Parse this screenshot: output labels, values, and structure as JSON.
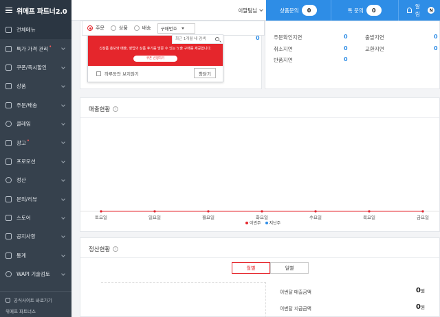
{
  "header": {
    "logo": "위메프 파트너2.0",
    "user_name": "이팔팀님",
    "inquiries": [
      {
        "label": "상품문의",
        "count": "0"
      },
      {
        "label": "톡 문의",
        "count": "0"
      }
    ],
    "notice_label": "알림",
    "notice_badge": "N"
  },
  "sidebar": {
    "items": [
      {
        "label": "전체메뉴",
        "icon": "grid-icon",
        "chevron": false,
        "dot": false
      },
      {
        "label": "특가 가격 관리",
        "icon": "price-tag-icon",
        "chevron": true,
        "dot": true
      },
      {
        "label": "쿠폰/즉시할인",
        "icon": "coupon-icon",
        "chevron": true,
        "dot": false
      },
      {
        "label": "상품",
        "icon": "product-box-icon",
        "chevron": true,
        "dot": false
      },
      {
        "label": "주문/배송",
        "icon": "delivery-truck-icon",
        "chevron": true,
        "dot": false
      },
      {
        "label": "클레임",
        "icon": "claim-icon",
        "chevron": true,
        "dot": false
      },
      {
        "label": "광고",
        "icon": "ad-icon",
        "chevron": true,
        "dot": true
      },
      {
        "label": "프로모션",
        "icon": "promotion-icon",
        "chevron": true,
        "dot": false
      },
      {
        "label": "정산",
        "icon": "settlement-icon",
        "chevron": true,
        "dot": false
      },
      {
        "label": "문의/리뷰",
        "icon": "chat-icon",
        "chevron": true,
        "dot": false
      },
      {
        "label": "스토어",
        "icon": "store-icon",
        "chevron": true,
        "dot": false
      },
      {
        "label": "공지사항",
        "icon": "megaphone-icon",
        "chevron": true,
        "dot": false
      },
      {
        "label": "통계",
        "icon": "stats-icon",
        "chevron": true,
        "dot": false
      },
      {
        "label": "WAPI 기술검토",
        "icon": "help-icon",
        "chevron": true,
        "dot": false
      }
    ],
    "footer": [
      {
        "label": "공식사이트 바로가기",
        "icon": "external-link-icon"
      },
      {
        "label": "위메프 파트너스",
        "icon": ""
      }
    ]
  },
  "search": {
    "radios": [
      {
        "label": "주문",
        "checked": true
      },
      {
        "label": "상품",
        "checked": false
      },
      {
        "label": "배송",
        "checked": false
      }
    ],
    "select_value": "구매번호",
    "placeholder": "최근 1개월 내 검색"
  },
  "popup": {
    "banner_text": "신상품 홍보와 매출, 영업의 상품 후기를 방문 수 있는 노출 구매를 제공합니다.",
    "banner_button": "쿠폰 신청하기",
    "dont_show_label": "하루동안 보지않기",
    "close_label": "창닫기"
  },
  "summary_right": {
    "rows": [
      {
        "label": "주문확인지연",
        "value": "0"
      },
      {
        "label": "취소지연",
        "value": "0"
      },
      {
        "label": "반품지연",
        "value": "0"
      }
    ],
    "rows2": [
      {
        "label": "출발지연",
        "value": "0"
      },
      {
        "label": "교환지연",
        "value": "0"
      }
    ],
    "left_value": "0"
  },
  "sales": {
    "title": "매출현황",
    "legend": [
      {
        "label": "이번주",
        "color": "#e5262c"
      },
      {
        "label": "지난주",
        "color": "#2e8de6"
      }
    ]
  },
  "chart_data": {
    "type": "line",
    "categories": [
      "토요일",
      "일요일",
      "월요일",
      "화요일",
      "수요일",
      "목요일",
      "금요일"
    ],
    "series": [
      {
        "name": "이번주",
        "values": [
          0,
          0,
          0,
          0,
          0,
          0,
          0
        ],
        "color": "#e5262c"
      },
      {
        "name": "지난주",
        "values": [
          0,
          0,
          0,
          0,
          0,
          0,
          0
        ],
        "color": "#2e8de6"
      }
    ],
    "ylim": [
      0,
      1
    ],
    "grid": false,
    "legend_position": "bottom-center"
  },
  "settlement": {
    "title": "정산현황",
    "tabs": [
      {
        "label": "월별",
        "active": true
      },
      {
        "label": "일별",
        "active": false
      }
    ],
    "rows": [
      {
        "label": "이번달 매출금액",
        "value": "0",
        "unit": "원"
      },
      {
        "label": "이번달 지급금액",
        "value": "0",
        "unit": "원"
      }
    ]
  }
}
